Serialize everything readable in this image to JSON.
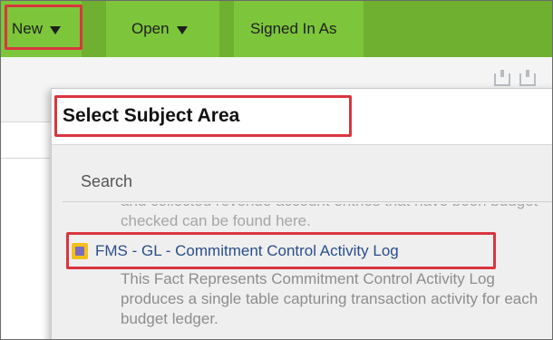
{
  "menubar": {
    "new_label": "New",
    "open_label": "Open",
    "signed_in_label": "Signed In As"
  },
  "dialog": {
    "title": "Select Subject Area",
    "search": {
      "placeholder": "Search",
      "value": ""
    },
    "previous_description": "and collected revenue account entries that have been budget checked can be found here.",
    "items": [
      {
        "name": "FMS - GL - Commitment Control Activity Log",
        "icon": "subject-area-icon",
        "description": "This Fact Represents Commitment Control Activity Log produces a single table capturing transaction activity for each budget ledger."
      }
    ]
  },
  "colors": {
    "menubar": "#6fb030",
    "menu_item": "#7dc63b",
    "highlight": "#d9363e",
    "link": "#2a4e8a",
    "description": "#8d8d8d"
  }
}
